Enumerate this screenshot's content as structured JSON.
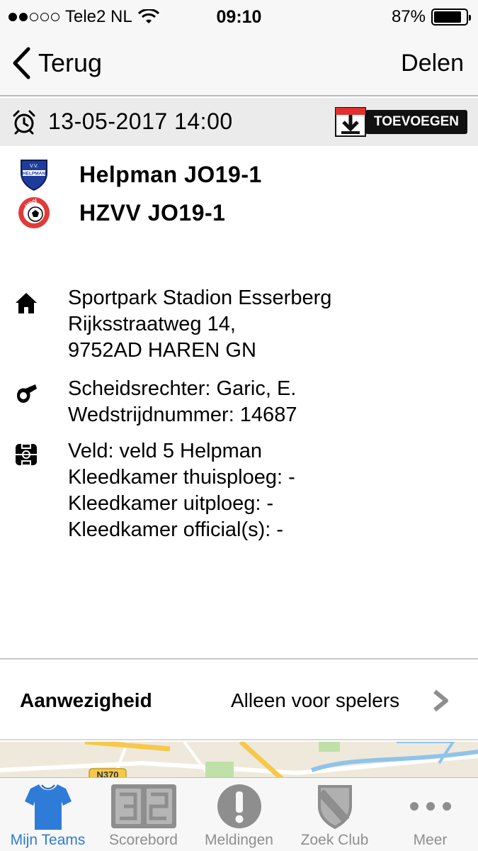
{
  "status_bar": {
    "carrier": "Tele2 NL",
    "time": "09:10",
    "battery": "87%",
    "battery_level": 0.87
  },
  "nav": {
    "back_label": "Terug",
    "share_label": "Delen"
  },
  "match": {
    "datetime": "13-05-2017 14:00",
    "add_button_label": "TOEVOEGEN",
    "home_team": "Helpman JO19-1",
    "home_logo_text": "HELPMAN",
    "away_team": "HZVV JO19-1",
    "away_logo_text": "HZVV"
  },
  "location": {
    "lines": [
      "Sportpark Stadion Esserberg",
      "Rijksstraatweg 14,",
      "9752AD HAREN GN"
    ]
  },
  "officials": {
    "lines": [
      "Scheidsrechter: Garic, E.",
      "Wedstrijdnummer: 14687"
    ]
  },
  "field": {
    "lines": [
      "Veld: veld 5 Helpman",
      "Kleedkamer thuisploeg: -",
      "Kleedkamer uitploeg: -",
      "Kleedkamer official(s): -"
    ]
  },
  "attendance": {
    "label": "Aanwezigheid",
    "value": "Alleen voor spelers"
  },
  "map": {
    "road_label": "N370"
  },
  "tabs": [
    {
      "label": "Mijn Teams",
      "icon": "shirt-icon",
      "active": true
    },
    {
      "label": "Scorebord",
      "icon": "scoreboard-icon",
      "active": false
    },
    {
      "label": "Meldingen",
      "icon": "exclamation-icon",
      "active": false
    },
    {
      "label": "Zoek Club",
      "icon": "shield-icon",
      "active": false
    },
    {
      "label": "Meer",
      "icon": "more-icon",
      "active": false
    }
  ],
  "colors": {
    "active_tab": "#2f7bd8",
    "inactive_tab": "#8e8e8e",
    "date_bar": "#ebebeb",
    "add_red": "#e03030"
  }
}
